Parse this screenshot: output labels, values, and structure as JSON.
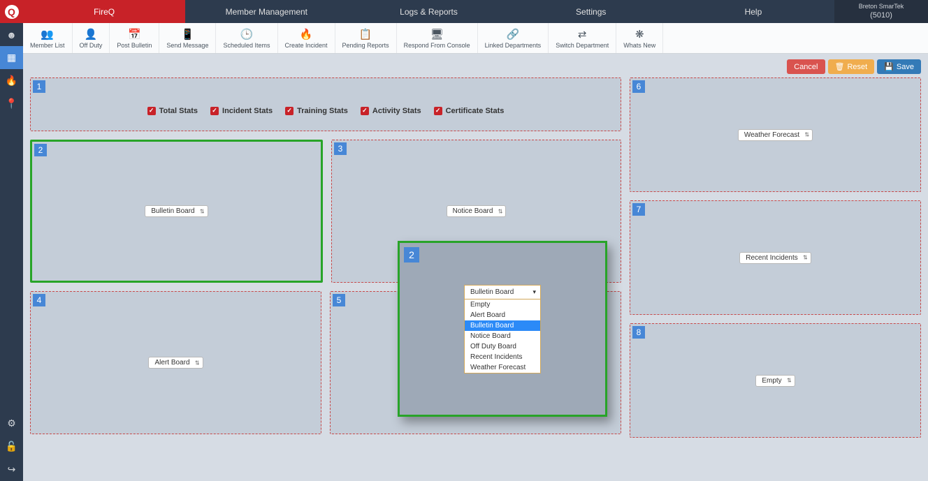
{
  "brand": "Q",
  "tabs": [
    "FireQ",
    "Member Management",
    "Logs & Reports",
    "Settings",
    "Help"
  ],
  "user": {
    "name": "Breton SmarTek",
    "id": "(5010)"
  },
  "toolbar": [
    {
      "icon": "👥",
      "label": "Member List"
    },
    {
      "icon": "👤",
      "label": "Off Duty"
    },
    {
      "icon": "📅",
      "label": "Post Bulletin"
    },
    {
      "icon": "📱",
      "label": "Send Message"
    },
    {
      "icon": "🕒",
      "label": "Scheduled Items"
    },
    {
      "icon": "🔥",
      "label": "Create Incident"
    },
    {
      "icon": "📋",
      "label": "Pending Reports"
    },
    {
      "icon": "🖥",
      "label": "Respond From Console"
    },
    {
      "icon": "🔗",
      "label": "Linked Departments"
    },
    {
      "icon": "⇄",
      "label": "Switch Department"
    },
    {
      "icon": "❋",
      "label": "Whats New"
    }
  ],
  "side_icons": [
    "☻",
    "▦",
    "🔥",
    "📍"
  ],
  "side_bottom": [
    "⚙",
    "🔓",
    "↪"
  ],
  "actions": {
    "cancel": "Cancel",
    "reset": "Reset",
    "save": "Save"
  },
  "stats": [
    "Total Stats",
    "Incident Stats",
    "Training Stats",
    "Activity Stats",
    "Certificate Stats"
  ],
  "panels": {
    "p2": "Bulletin Board",
    "p3": "Notice Board",
    "p4": "Alert Board",
    "p6": "Weather Forecast",
    "p7": "Recent Incidents",
    "p8": "Empty"
  },
  "overlay": {
    "num": "2",
    "selected": "Bulletin Board",
    "options": [
      "Empty",
      "Alert Board",
      "Bulletin Board",
      "Notice Board",
      "Off Duty Board",
      "Recent Incidents",
      "Weather Forecast"
    ]
  },
  "nums": {
    "n1": "1",
    "n2": "2",
    "n3": "3",
    "n4": "4",
    "n5": "5",
    "n6": "6",
    "n7": "7",
    "n8": "8"
  }
}
